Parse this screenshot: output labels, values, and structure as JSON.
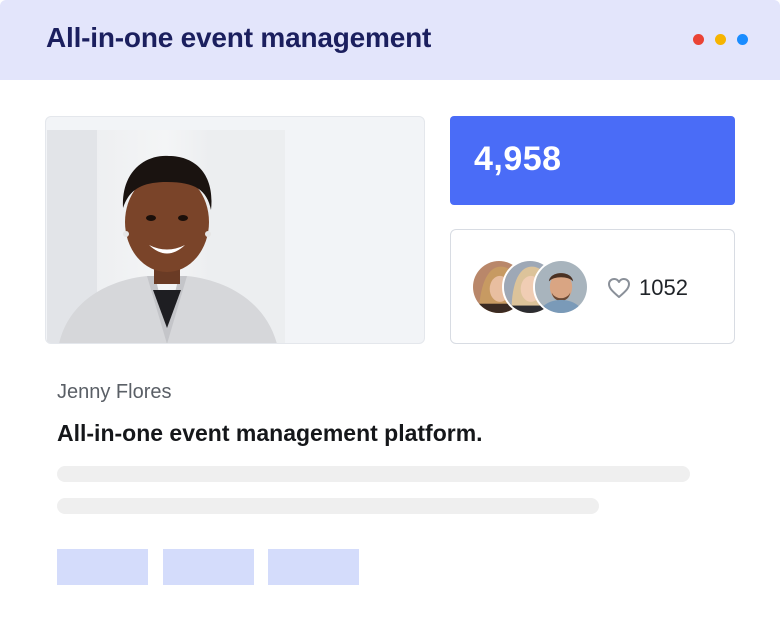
{
  "header": {
    "title": "All-in-one event management",
    "window_dots": [
      {
        "name": "red",
        "color": "#ea4335"
      },
      {
        "name": "yellow",
        "color": "#f6b400"
      },
      {
        "name": "blue",
        "color": "#1a8cff"
      }
    ]
  },
  "profile": {
    "photo_icon": "person-portrait-icon",
    "name": "Jenny Flores",
    "headline": "All-in-one event management platform."
  },
  "stats": {
    "value": "4,958",
    "accent": "#4a6cf7"
  },
  "social": {
    "avatars": [
      "attendee-avatar-1",
      "attendee-avatar-2",
      "attendee-avatar-3"
    ],
    "like_icon": "heart-icon",
    "likes": "1052"
  },
  "colors": {
    "titlebar_bg": "#e3e5fb",
    "title_text": "#1b1f5e",
    "chip_bg": "#d4dcfb"
  }
}
